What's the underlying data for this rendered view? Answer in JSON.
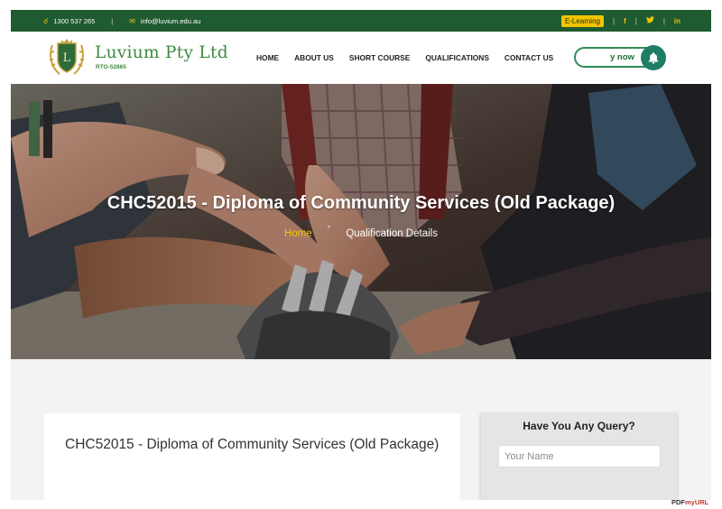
{
  "topbar": {
    "phone": "1300 537 265",
    "email": "info@luvium.edu.au",
    "elearning_label": "E-Learning",
    "social": [
      "f",
      "t",
      "in"
    ]
  },
  "header": {
    "brand": "Luvium Pty Ltd",
    "rto": "RTO-52865",
    "logo_letter": "L",
    "nav": [
      "HOME",
      "ABOUT US",
      "SHORT COURSE",
      "QUALIFICATIONS",
      "CONTACT US"
    ],
    "enroll_label": "y now"
  },
  "hero": {
    "title": "CHC52015 - Diploma of Community Services (Old Package)",
    "breadcrumb_home": "Home",
    "breadcrumb_sep": "°",
    "breadcrumb_current": "Qualification Details"
  },
  "content": {
    "card_title": "CHC52015 - Diploma of Community Services (Old Package)"
  },
  "query_form": {
    "title": "Have You Any Query?",
    "name_placeholder": "Your Name"
  },
  "footer_mark": {
    "text_a": "PDF",
    "text_b": "myURL"
  },
  "colors": {
    "topbar": "#1f5a30",
    "accent_yellow": "#f2c400",
    "brand_green": "#3d8b40",
    "bell": "#1f7d65"
  }
}
